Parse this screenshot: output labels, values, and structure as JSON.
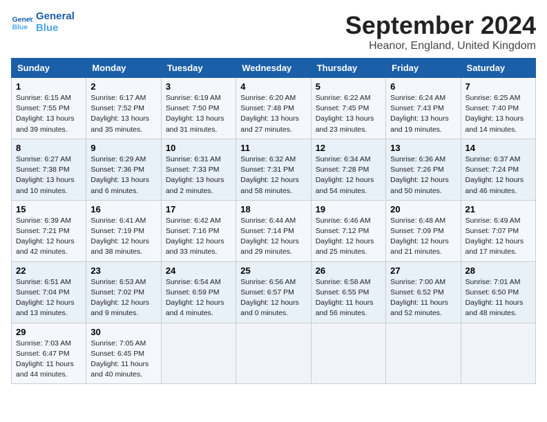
{
  "header": {
    "logo": {
      "line1": "General",
      "line2": "Blue"
    },
    "title": "September 2024",
    "location": "Heanor, England, United Kingdom"
  },
  "weekdays": [
    "Sunday",
    "Monday",
    "Tuesday",
    "Wednesday",
    "Thursday",
    "Friday",
    "Saturday"
  ],
  "weeks": [
    [
      {
        "day": "1",
        "sunrise": "6:15 AM",
        "sunset": "7:55 PM",
        "daylight": "13 hours and 39 minutes."
      },
      {
        "day": "2",
        "sunrise": "6:17 AM",
        "sunset": "7:52 PM",
        "daylight": "13 hours and 35 minutes."
      },
      {
        "day": "3",
        "sunrise": "6:19 AM",
        "sunset": "7:50 PM",
        "daylight": "13 hours and 31 minutes."
      },
      {
        "day": "4",
        "sunrise": "6:20 AM",
        "sunset": "7:48 PM",
        "daylight": "13 hours and 27 minutes."
      },
      {
        "day": "5",
        "sunrise": "6:22 AM",
        "sunset": "7:45 PM",
        "daylight": "13 hours and 23 minutes."
      },
      {
        "day": "6",
        "sunrise": "6:24 AM",
        "sunset": "7:43 PM",
        "daylight": "13 hours and 19 minutes."
      },
      {
        "day": "7",
        "sunrise": "6:25 AM",
        "sunset": "7:40 PM",
        "daylight": "13 hours and 14 minutes."
      }
    ],
    [
      {
        "day": "8",
        "sunrise": "6:27 AM",
        "sunset": "7:38 PM",
        "daylight": "13 hours and 10 minutes."
      },
      {
        "day": "9",
        "sunrise": "6:29 AM",
        "sunset": "7:36 PM",
        "daylight": "13 hours and 6 minutes."
      },
      {
        "day": "10",
        "sunrise": "6:31 AM",
        "sunset": "7:33 PM",
        "daylight": "13 hours and 2 minutes."
      },
      {
        "day": "11",
        "sunrise": "6:32 AM",
        "sunset": "7:31 PM",
        "daylight": "12 hours and 58 minutes."
      },
      {
        "day": "12",
        "sunrise": "6:34 AM",
        "sunset": "7:28 PM",
        "daylight": "12 hours and 54 minutes."
      },
      {
        "day": "13",
        "sunrise": "6:36 AM",
        "sunset": "7:26 PM",
        "daylight": "12 hours and 50 minutes."
      },
      {
        "day": "14",
        "sunrise": "6:37 AM",
        "sunset": "7:24 PM",
        "daylight": "12 hours and 46 minutes."
      }
    ],
    [
      {
        "day": "15",
        "sunrise": "6:39 AM",
        "sunset": "7:21 PM",
        "daylight": "12 hours and 42 minutes."
      },
      {
        "day": "16",
        "sunrise": "6:41 AM",
        "sunset": "7:19 PM",
        "daylight": "12 hours and 38 minutes."
      },
      {
        "day": "17",
        "sunrise": "6:42 AM",
        "sunset": "7:16 PM",
        "daylight": "12 hours and 33 minutes."
      },
      {
        "day": "18",
        "sunrise": "6:44 AM",
        "sunset": "7:14 PM",
        "daylight": "12 hours and 29 minutes."
      },
      {
        "day": "19",
        "sunrise": "6:46 AM",
        "sunset": "7:12 PM",
        "daylight": "12 hours and 25 minutes."
      },
      {
        "day": "20",
        "sunrise": "6:48 AM",
        "sunset": "7:09 PM",
        "daylight": "12 hours and 21 minutes."
      },
      {
        "day": "21",
        "sunrise": "6:49 AM",
        "sunset": "7:07 PM",
        "daylight": "12 hours and 17 minutes."
      }
    ],
    [
      {
        "day": "22",
        "sunrise": "6:51 AM",
        "sunset": "7:04 PM",
        "daylight": "12 hours and 13 minutes."
      },
      {
        "day": "23",
        "sunrise": "6:53 AM",
        "sunset": "7:02 PM",
        "daylight": "12 hours and 9 minutes."
      },
      {
        "day": "24",
        "sunrise": "6:54 AM",
        "sunset": "6:59 PM",
        "daylight": "12 hours and 4 minutes."
      },
      {
        "day": "25",
        "sunrise": "6:56 AM",
        "sunset": "6:57 PM",
        "daylight": "12 hours and 0 minutes."
      },
      {
        "day": "26",
        "sunrise": "6:58 AM",
        "sunset": "6:55 PM",
        "daylight": "11 hours and 56 minutes."
      },
      {
        "day": "27",
        "sunrise": "7:00 AM",
        "sunset": "6:52 PM",
        "daylight": "11 hours and 52 minutes."
      },
      {
        "day": "28",
        "sunrise": "7:01 AM",
        "sunset": "6:50 PM",
        "daylight": "11 hours and 48 minutes."
      }
    ],
    [
      {
        "day": "29",
        "sunrise": "7:03 AM",
        "sunset": "6:47 PM",
        "daylight": "11 hours and 44 minutes."
      },
      {
        "day": "30",
        "sunrise": "7:05 AM",
        "sunset": "6:45 PM",
        "daylight": "11 hours and 40 minutes."
      },
      null,
      null,
      null,
      null,
      null
    ]
  ]
}
